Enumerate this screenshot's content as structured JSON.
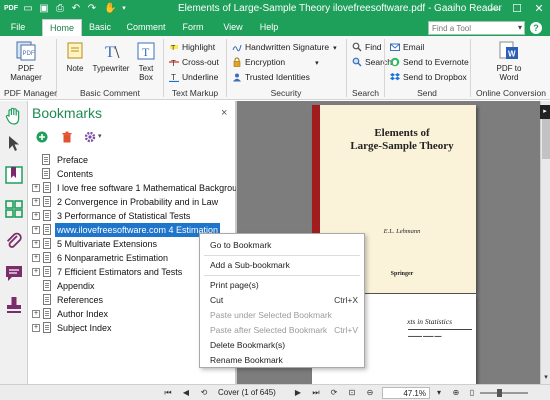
{
  "window": {
    "title": "Elements of Large-Sample Theory ilovefreesoftware.pdf - Gaaiho Reader",
    "minimize": "—",
    "maximize": "☐",
    "close": "✕"
  },
  "tabs": [
    {
      "label": "File"
    },
    {
      "label": "Home"
    },
    {
      "label": "Basic"
    },
    {
      "label": "Comment"
    },
    {
      "label": "Form"
    },
    {
      "label": "View"
    },
    {
      "label": "Help"
    }
  ],
  "find": {
    "placeholder": "Find a Tool"
  },
  "help_icon": "?",
  "ribbon": {
    "groups": {
      "pdf_manager": "PDF Manager",
      "basic_comment": "Basic Comment",
      "text_markup": "Text Markup",
      "security": "Security",
      "search": "Search",
      "send": "Send",
      "online_conversion": "Online Conversion"
    },
    "pdf_manager_btn": "PDF\nManager",
    "note_btn": "Note",
    "typewriter_btn": "Typewriter",
    "textbox_btn": "Text\nBox",
    "highlight": "Highlight",
    "crossout": "Cross-out",
    "underline": "Underline",
    "handwritten": "Handwritten Signature",
    "encryption": "Encryption",
    "trusted": "Trusted Identities",
    "find_btn": "Find",
    "search_btn": "Search",
    "email": "Email",
    "evernote": "Send to Evernote",
    "dropbox": "Send to Dropbox",
    "pdf_to_word": "PDF to\nWord"
  },
  "bookmarks": {
    "title": "Bookmarks",
    "close": "×",
    "items": [
      {
        "label": "Preface",
        "expandable": false
      },
      {
        "label": "Contents",
        "expandable": false
      },
      {
        "label": "I love free software 1 Mathematical Background",
        "expandable": true
      },
      {
        "label": "2 Convergence in Probability and in Law",
        "expandable": true
      },
      {
        "label": "3 Performance of Statistical Tests",
        "expandable": true
      },
      {
        "label": "www.ilovefreesoftware.com 4 Estimation",
        "expandable": true,
        "selected": true
      },
      {
        "label": "5 Multivariate Extensions",
        "expandable": true
      },
      {
        "label": "6 Nonparametric Estimation",
        "expandable": true
      },
      {
        "label": "7 Efficient Estimators and Tests",
        "expandable": true
      },
      {
        "label": "Appendix",
        "expandable": false
      },
      {
        "label": "References",
        "expandable": false
      },
      {
        "label": "Author Index",
        "expandable": true
      },
      {
        "label": "Subject Index",
        "expandable": true
      }
    ]
  },
  "context_menu": {
    "items": [
      {
        "label": "Go to Bookmark",
        "shortcut": "",
        "disabled": false
      },
      {
        "label": "Add a Sub-bookmark",
        "shortcut": "",
        "disabled": false
      },
      {
        "label": "Print page(s)",
        "shortcut": "",
        "disabled": false
      },
      {
        "label": "Cut",
        "shortcut": "Ctrl+X",
        "disabled": false
      },
      {
        "label": "Paste under Selected Bookmark",
        "shortcut": "",
        "disabled": true
      },
      {
        "label": "Paste after Selected Bookmark",
        "shortcut": "Ctrl+V",
        "disabled": true
      },
      {
        "label": "Delete Bookmark(s)",
        "shortcut": "",
        "disabled": false
      },
      {
        "label": "Rename Bookmark",
        "shortcut": "",
        "disabled": false
      }
    ]
  },
  "document": {
    "book_title": "Elements of\nLarge-Sample Theory",
    "book_author": "E.L. Lehmann",
    "book_publisher": "Springer",
    "page2_title": "xts in Statistics"
  },
  "status": {
    "page": "Cover  (1 of 645)",
    "zoom": "47.1%"
  },
  "colors": {
    "accent": "#1e9f5a",
    "selection": "#1f75c9",
    "spine": "#a11d1d"
  }
}
